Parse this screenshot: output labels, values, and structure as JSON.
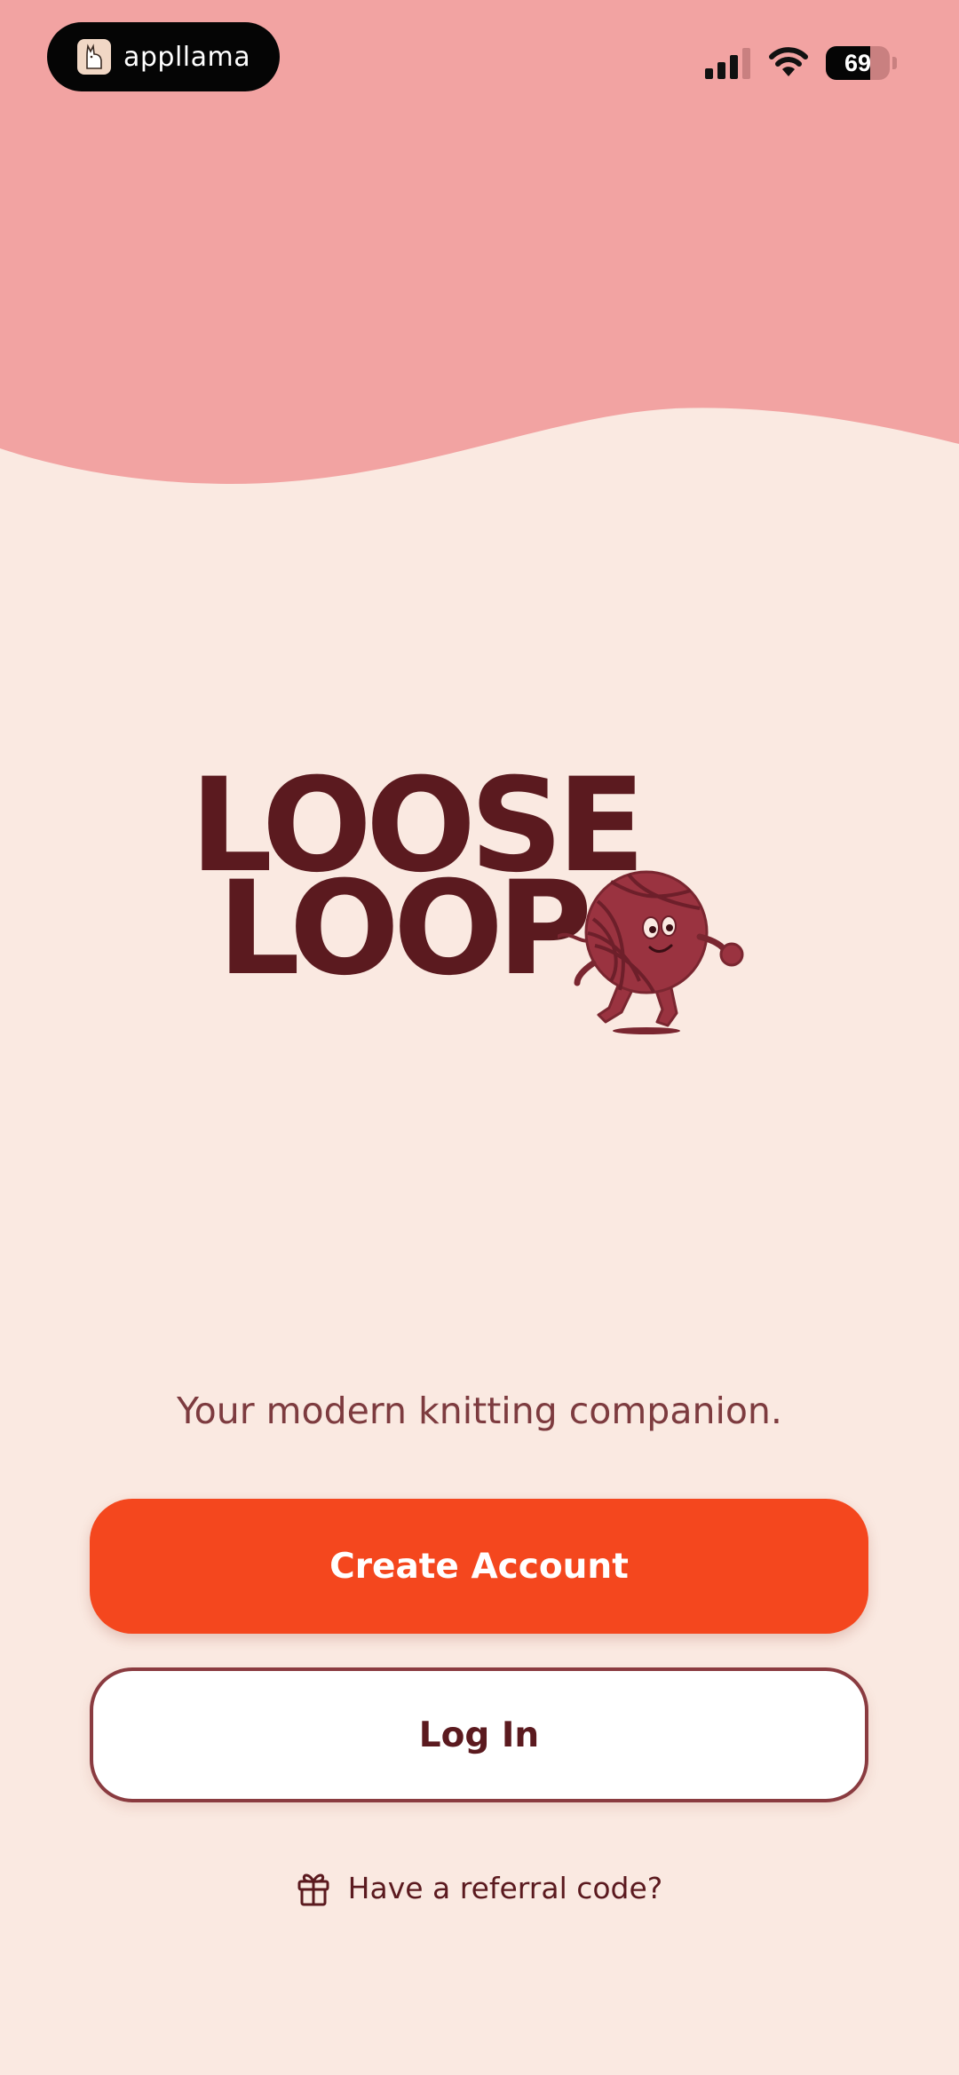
{
  "status_bar": {
    "recorder_label": "appllama",
    "battery_level": "69",
    "battery_fraction": 0.69,
    "icons": [
      "recorder-logo-icon",
      "cellular-signal-icon",
      "wifi-icon",
      "battery-icon"
    ]
  },
  "brand": {
    "logo_line_1": "LOOSE",
    "logo_line_2": "LOOP",
    "mascot": "yarn-ball-mascot-icon"
  },
  "tagline": "Your modern knitting companion.",
  "actions": {
    "create_account_label": "Create Account",
    "log_in_label": "Log In",
    "referral_label": "Have a referral code?",
    "referral_icon": "gift-icon"
  },
  "colors": {
    "header_pink": "#f2a3a2",
    "background_cream": "#fae9e1",
    "brand_maroon": "#5b1a1f",
    "mascot_red": "#9a3340",
    "primary_orange": "#f4471e",
    "login_border": "#8a3b40"
  }
}
